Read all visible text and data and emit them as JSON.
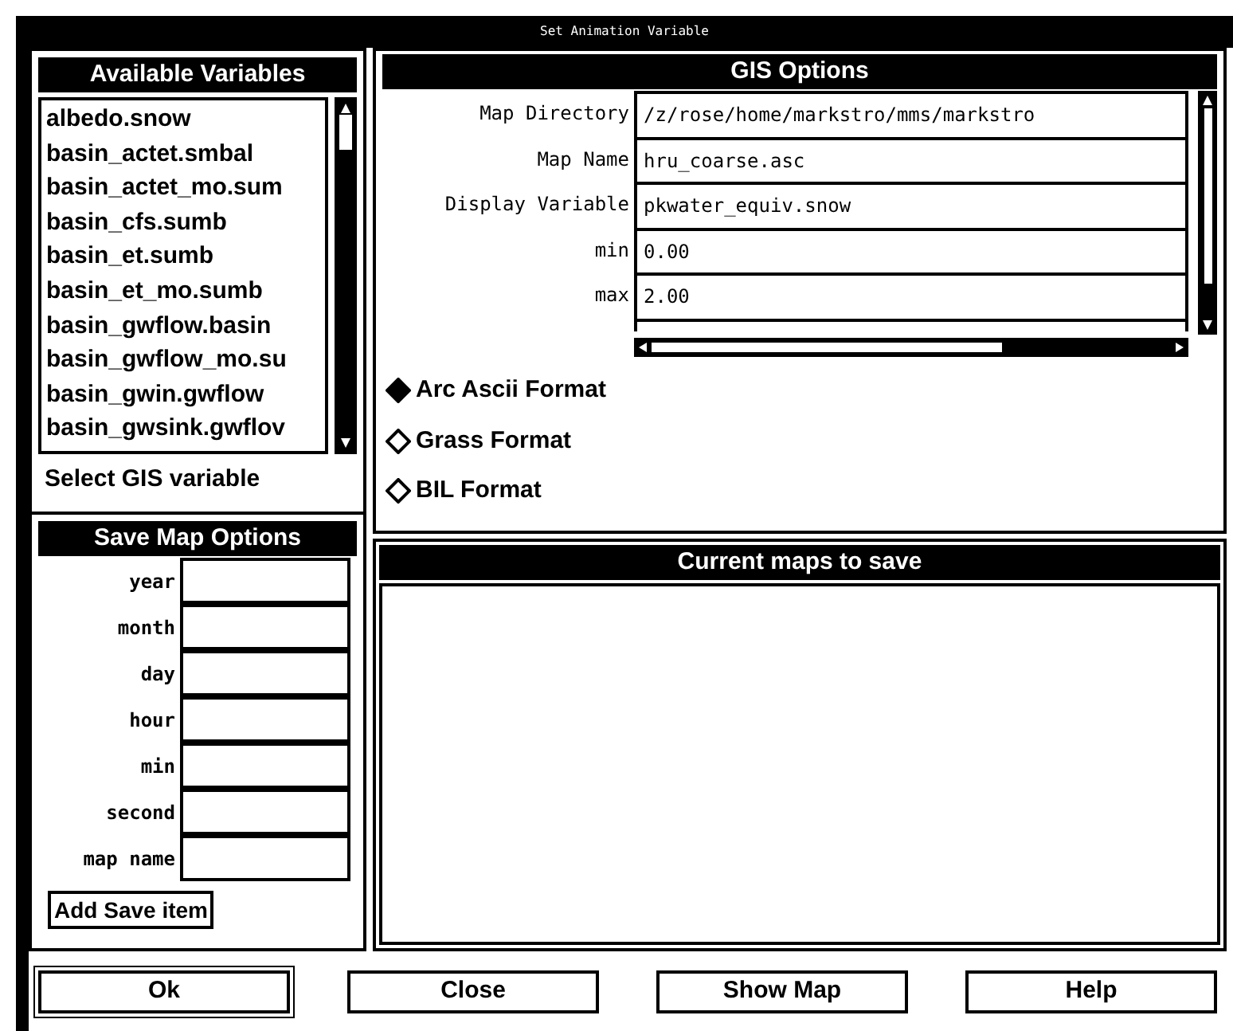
{
  "window": {
    "title": "Set Animation Variable"
  },
  "available_variables": {
    "title": "Available Variables",
    "items": [
      {
        "label": "albedo.snow",
        "selected": false
      },
      {
        "label": "basin_actet.smbal",
        "selected": false
      },
      {
        "label": "basin_actet_mo.sum",
        "selected": false
      },
      {
        "label": "basin_cfs.sumb",
        "selected": false
      },
      {
        "label": "basin_et.sumb",
        "selected": false
      },
      {
        "label": "basin_et_mo.sumb",
        "selected": false
      },
      {
        "label": "basin_gwflow.basin",
        "selected": false
      },
      {
        "label": "basin_gwflow_mo.su",
        "selected": false
      },
      {
        "label": "basin_gwin.gwflow",
        "selected": false
      },
      {
        "label": "basin_gwsink.gwflov",
        "selected": false
      }
    ],
    "caption": "Select GIS variable"
  },
  "gis_options": {
    "title": "GIS Options",
    "fields": [
      {
        "label": "Map Directory",
        "value": "/z/rose/home/markstro/mms/markstro"
      },
      {
        "label": "Map Name",
        "value": "hru_coarse.asc"
      },
      {
        "label": "Display Variable",
        "value": "pkwater_equiv.snow"
      },
      {
        "label": "min",
        "value": "0.00"
      },
      {
        "label": "max",
        "value": "2.00"
      }
    ],
    "formats": [
      {
        "label": "Arc Ascii Format",
        "selected": true
      },
      {
        "label": "Grass Format",
        "selected": false
      },
      {
        "label": "BIL Format",
        "selected": false
      }
    ]
  },
  "save_map_options": {
    "title": "Save Map Options",
    "fields": [
      {
        "label": "year"
      },
      {
        "label": "month"
      },
      {
        "label": "day"
      },
      {
        "label": "hour"
      },
      {
        "label": "min"
      },
      {
        "label": "second"
      },
      {
        "label": "map name"
      }
    ],
    "add_button": "Add Save item"
  },
  "current_maps": {
    "title": "Current maps to save"
  },
  "buttons": [
    "Ok",
    "Close",
    "Show Map",
    "Help"
  ]
}
